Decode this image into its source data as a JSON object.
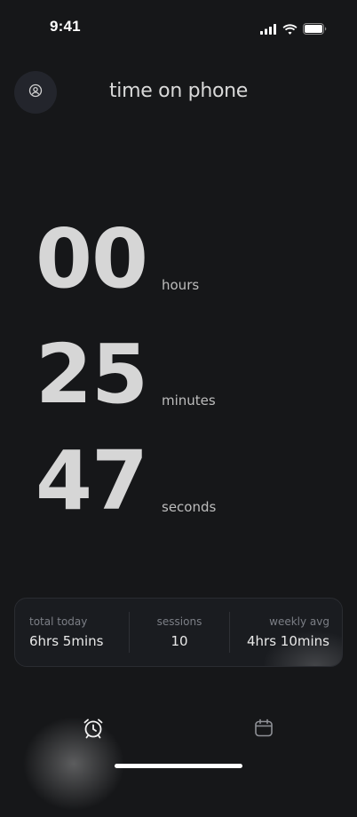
{
  "status_bar": {
    "time": "9:41",
    "icons": [
      "cellular-signal-icon",
      "wifi-icon",
      "battery-icon"
    ]
  },
  "header": {
    "title": "time on phone",
    "profile_icon": "user-circle-icon"
  },
  "timer": {
    "hours": {
      "value": "00",
      "unit": "hours"
    },
    "minutes": {
      "value": "25",
      "unit": "minutes"
    },
    "seconds": {
      "value": "47",
      "unit": "seconds"
    }
  },
  "stats": {
    "total_today": {
      "label": "total today",
      "value": "6hrs 5mins"
    },
    "sessions": {
      "label": "sessions",
      "value": "10"
    },
    "weekly_avg": {
      "label": "weekly avg",
      "value": "4hrs 10mins"
    }
  },
  "tab_bar": {
    "tabs": [
      {
        "icon": "alarm-clock-icon",
        "active": true
      },
      {
        "icon": "calendar-icon",
        "active": false
      }
    ]
  },
  "colors": {
    "background": "#161719",
    "card": "#1a1c20",
    "text_primary": "#d6d6d6",
    "text_muted": "#7c7f86"
  }
}
